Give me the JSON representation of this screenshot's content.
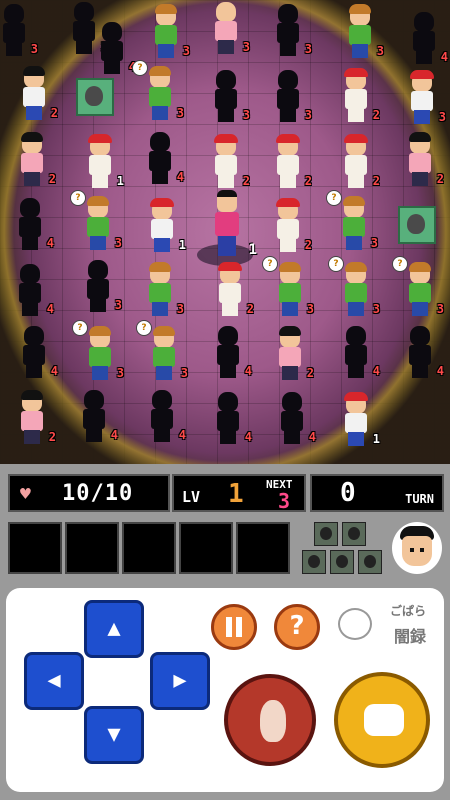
{
  "status": {
    "hp_icon": "heart-icon",
    "hp_value": "10/10",
    "level_label": "LV",
    "level": "1",
    "next_label": "NEXT",
    "next_value": "3",
    "turn_value": "0",
    "turn_label": "TURN"
  },
  "board": {
    "player_number": "1"
  },
  "controls": {
    "help_label": "?",
    "dpad": {
      "up": "▲",
      "down": "▼",
      "left": "◀",
      "right": "▶"
    }
  },
  "logo": {
    "text_line1": "ごぱら",
    "text_line2": "闇録"
  },
  "colors": {
    "accent_level": "#f0a23a",
    "accent_next": "#ff4a8a",
    "dpad": "#1e4fcf",
    "step": "#b4382a",
    "punch": "#f0b21a"
  }
}
